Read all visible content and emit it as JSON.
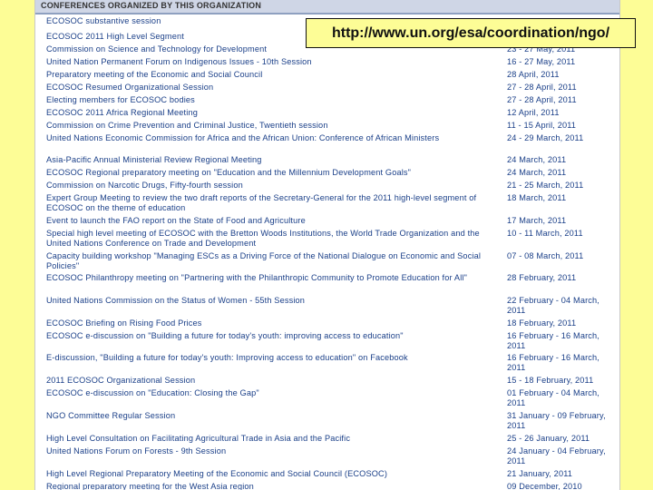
{
  "header": {
    "section_title": "CONFERENCES ORGANIZED BY THIS ORGANIZATION"
  },
  "banner": {
    "url": "http://www.un.org/esa/coordination/ngo/"
  },
  "events": [
    {
      "name": "ECOSOC substantive session",
      "date": ""
    },
    {
      "name": "ECOSOC 2011 High Level Segment",
      "date": ""
    },
    {
      "name": "Commission on Science and Technology for Development",
      "date": "23 - 27 May, 2011"
    },
    {
      "name": "United Nation Permanent Forum on Indigenous Issues - 10th Session",
      "date": "16 - 27 May, 2011"
    },
    {
      "name": "Preparatory meeting of the Economic and Social Council",
      "date": "28 April, 2011"
    },
    {
      "name": "ECOSOC Resumed Organizational Session",
      "date": "27 - 28 April, 2011"
    },
    {
      "name": "Electing members for ECOSOC bodies",
      "date": "27 - 28 April, 2011"
    },
    {
      "name": "ECOSOC 2011 Africa Regional Meeting",
      "date": "12 April, 2011"
    },
    {
      "name": "Commission on Crime Prevention and Criminal Justice, Twentieth session",
      "date": "11 - 15 April, 2011"
    },
    {
      "name": "United Nations Economic Commission for Africa and the African Union: Conference of African Ministers",
      "date": "24 - 29 March, 2011"
    },
    {
      "name": "Asia-Pacific Annual Ministerial Review Regional Meeting",
      "date": "24 March, 2011"
    },
    {
      "name": "ECOSOC Regional preparatory meeting on \"Education and the Millennium Development Goals\"",
      "date": "24 March, 2011"
    },
    {
      "name": "Commission on Narcotic Drugs, Fifty-fourth session",
      "date": "21 - 25 March, 2011"
    },
    {
      "name": "Expert Group Meeting to review the two draft reports of the Secretary-General for the 2011 high-level segment of ECOSOC on the theme of education",
      "date": "18 March, 2011"
    },
    {
      "name": "Event to launch the FAO report on the State of Food and Agriculture",
      "date": "17 March, 2011"
    },
    {
      "name": "Special high level meeting of ECOSOC with the Bretton Woods Institutions, the World Trade Organization and the United Nations Conference on Trade and Development",
      "date": "10 - 11 March, 2011"
    },
    {
      "name": "Capacity building workshop \"Managing ESCs as a Driving Force of the National Dialogue on Economic and Social Policies\"",
      "date": "07 - 08 March, 2011"
    },
    {
      "name": "ECOSOC Philanthropy meeting on \"Partnering with the Philanthropic Community to Promote Education for All\"",
      "date": "28 February, 2011"
    },
    {
      "name": "United Nations Commission on the Status of Women - 55th Session",
      "date": "22 February - 04 March, 2011"
    },
    {
      "name": "ECOSOC Briefing on Rising Food Prices",
      "date": "18 February, 2011"
    },
    {
      "name": "ECOSOC e-discussion on \"Building a future for today's youth: improving access to education\"",
      "date": "16 February - 16 March, 2011"
    },
    {
      "name": "E-discussion, \"Building a future for today's youth: Improving access to education\" on Facebook",
      "date": "16 February - 16 March, 2011"
    },
    {
      "name": "2011 ECOSOC Organizational Session",
      "date": "15 - 18 February, 2011"
    },
    {
      "name": "ECOSOC e-discussion on \"Education: Closing the Gap\"",
      "date": "01 February - 04 March, 2011"
    },
    {
      "name": "NGO Committee Regular Session",
      "date": "31 January - 09 February, 2011"
    },
    {
      "name": "High Level Consultation on Facilitating Agricultural Trade in Asia and the Pacific",
      "date": "25 - 26 January, 2011"
    },
    {
      "name": "United Nations Forum on Forests - 9th Session",
      "date": "24 January - 04 February, 2011"
    },
    {
      "name": "High Level Regional Preparatory Meeting of the Economic and Social Council (ECOSOC)",
      "date": "21 January, 2011"
    },
    {
      "name": "Regional preparatory meeting for the West Asia region",
      "date": "09 December, 2010"
    }
  ]
}
